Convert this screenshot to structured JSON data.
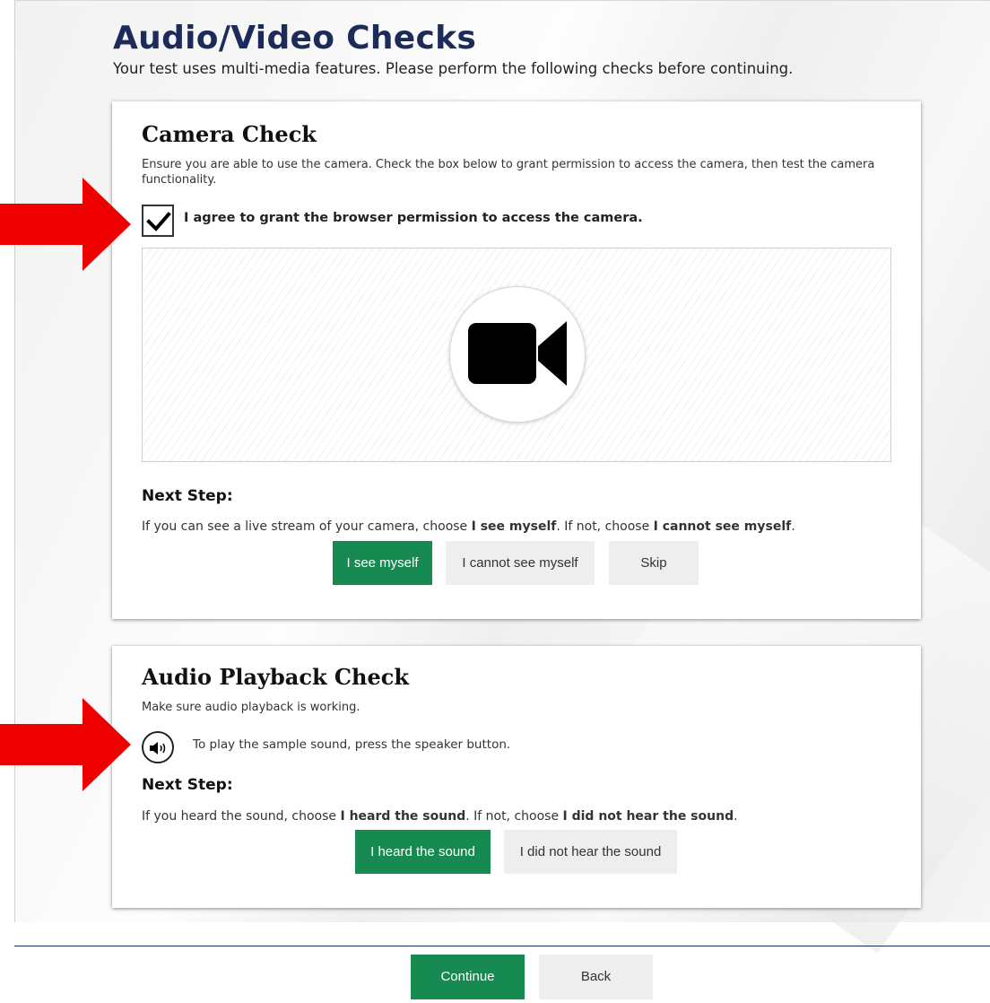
{
  "header": {
    "title": "Audio/Video Checks",
    "subtitle": "Your test uses multi-media features. Please perform the following checks before continuing."
  },
  "camera_check": {
    "title": "Camera Check",
    "description": "Ensure you are able to use the camera. Check the box below to grant permission to access the camera, then test the camera functionality.",
    "checkbox_checked": true,
    "checkbox_label": "I agree to grant the browser permission to access the camera.",
    "camera_icon": "video-camera-icon",
    "next_step_heading": "Next Step:",
    "instruction": {
      "part1": "If you can see a live stream of your camera, choose ",
      "bold1": "I see myself",
      "part2": ". If not, choose ",
      "bold2": "I cannot see myself",
      "part3": "."
    },
    "buttons": {
      "see_myself": "I see myself",
      "cannot_see": "I cannot see myself",
      "skip": "Skip"
    }
  },
  "audio_check": {
    "title": "Audio Playback Check",
    "description": "Make sure audio playback is working.",
    "speaker_icon": "speaker-icon",
    "speaker_text": "To play the sample sound, press the speaker button.",
    "next_step_heading": "Next Step:",
    "instruction": {
      "part1": "If you heard the sound, choose ",
      "bold1": "I heard the sound",
      "part2": ". If not, choose ",
      "bold2": "I did not hear the sound",
      "part3": "."
    },
    "buttons": {
      "heard": "I heard the sound",
      "not_heard": "I did not hear the sound"
    }
  },
  "footer": {
    "continue": "Continue",
    "back": "Back"
  },
  "colors": {
    "accent_green": "#178a52",
    "title_navy": "#1d2b5a",
    "annotation_red": "#ee0000"
  }
}
